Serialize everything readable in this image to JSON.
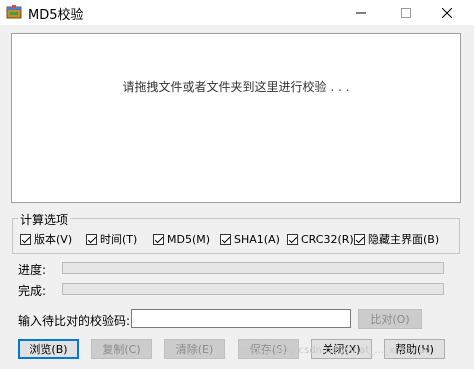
{
  "window": {
    "title": "MD5校验",
    "minimize_glyph": "—",
    "maximize_glyph": "☐",
    "close_glyph": "✕"
  },
  "drop_area": {
    "hint": "请拖拽文件或者文件夹到这里进行校验 . . ."
  },
  "options": {
    "group_label": "计算选项",
    "items": [
      {
        "label": "版本(V)",
        "checked": true
      },
      {
        "label": "时间(T)",
        "checked": true
      },
      {
        "label": "MD5(M)",
        "checked": true
      },
      {
        "label": "SHA1(A)",
        "checked": true
      },
      {
        "label": "CRC32(R)",
        "checked": true
      },
      {
        "label": "隐藏主界面(B)",
        "checked": true
      }
    ]
  },
  "progress": {
    "label": "进度:",
    "value": 0,
    "done_label": "完成:",
    "done_value": 0
  },
  "compare": {
    "label": "输入待比对的校验码:",
    "value": "",
    "button": "比对(O)"
  },
  "buttons": {
    "browse": "浏览(B)",
    "copy": "复制(C)",
    "clear": "清除(E)",
    "save": "保存(S)",
    "close": "关闭(X)",
    "help": "帮助(H)"
  },
  "watermark": "https://blog.csdn.net/sinat_..._xiaoxiao",
  "colors": {
    "titlebar": "#ffffff",
    "window": "#f0f0f0",
    "accent": "#0078d7"
  }
}
